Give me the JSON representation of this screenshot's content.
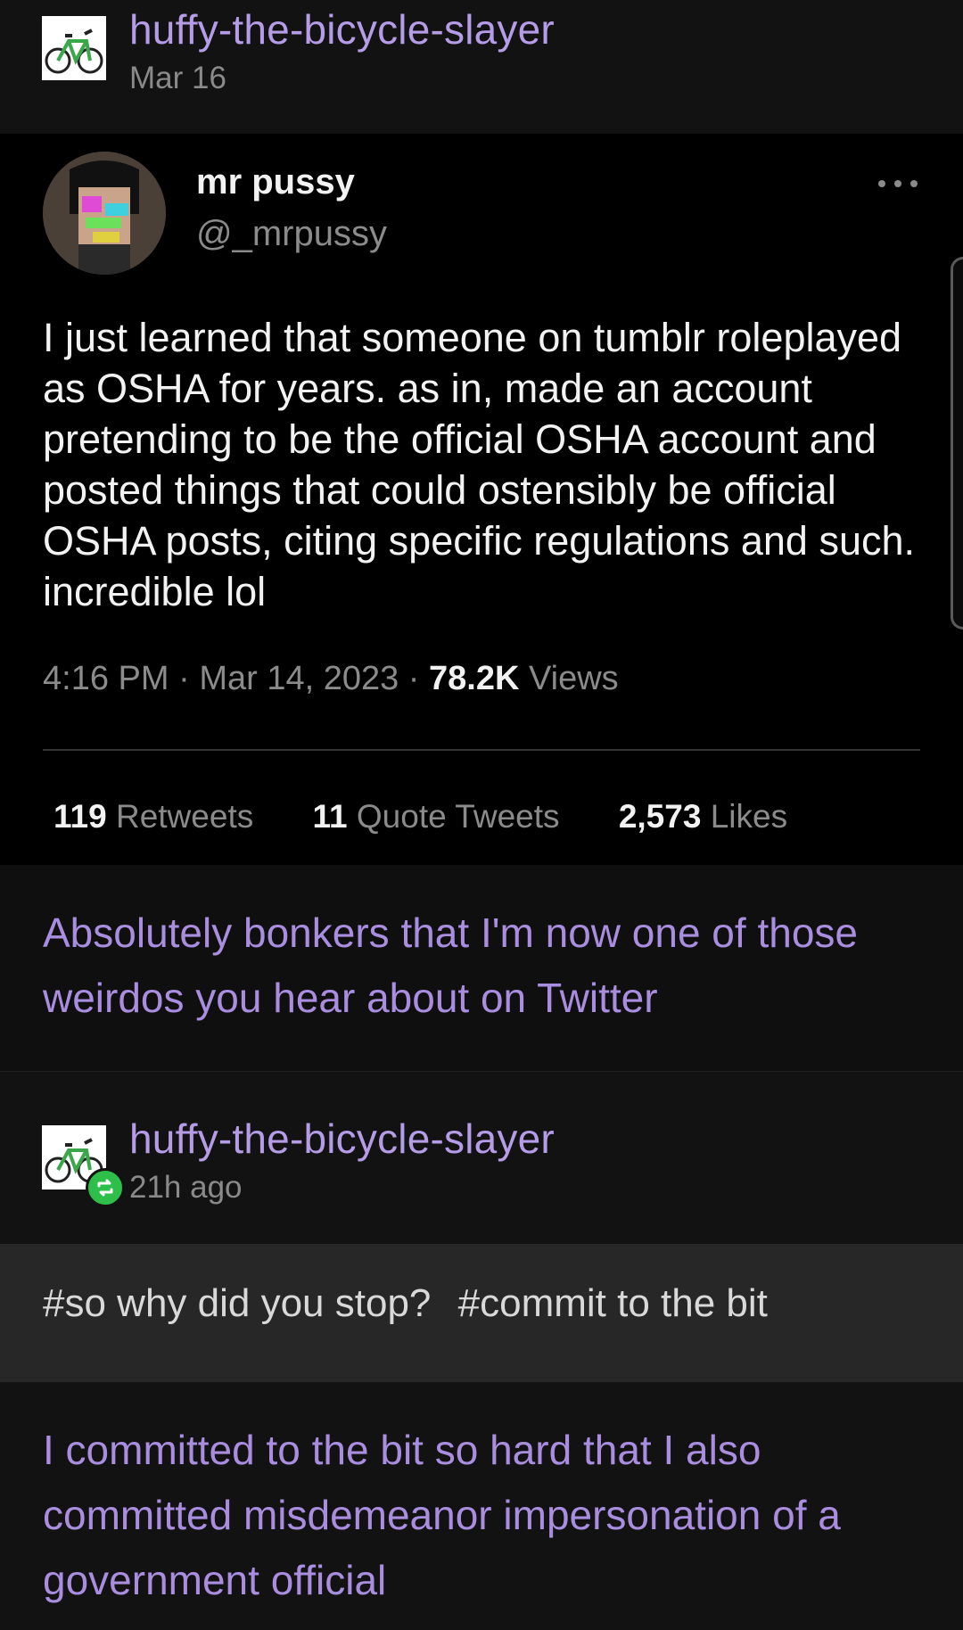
{
  "post": {
    "author": "huffy-the-bicycle-slayer",
    "date": "Mar 16"
  },
  "tweet": {
    "display_name": "mr pussy",
    "handle": "@_mrpussy",
    "text": "I just learned that someone on tumblr roleplayed as OSHA for years. as in, made an account pretending to be the official OSHA account and posted things that could ostensibly be official OSHA posts, citing specific regulations and such. incredible lol",
    "time": "4:16 PM",
    "date": "Mar 14, 2023",
    "views_count": "78.2K",
    "views_label": "Views",
    "retweets_count": "119",
    "retweets_label": "Retweets",
    "quotes_count": "11",
    "quotes_label": "Quote Tweets",
    "likes_count": "2,573",
    "likes_label": "Likes"
  },
  "reply1": {
    "text": "Absolutely bonkers that I'm now one of those weirdos you hear about on Twitter"
  },
  "reblog": {
    "author": "huffy-the-bicycle-slayer",
    "time": "21h ago",
    "tags": [
      "#so why did you stop?",
      "#commit to the bit"
    ]
  },
  "reply2": {
    "text": "I committed to the bit so hard that I also committed misdemeanor impersonation of a government official"
  },
  "colors": {
    "accent_purple": "#a98ee0",
    "reblog_green": "#2dbf4a",
    "background": "#121212"
  },
  "icons": [
    "bicycle-avatar-icon",
    "more-options-icon",
    "reblog-icon"
  ]
}
